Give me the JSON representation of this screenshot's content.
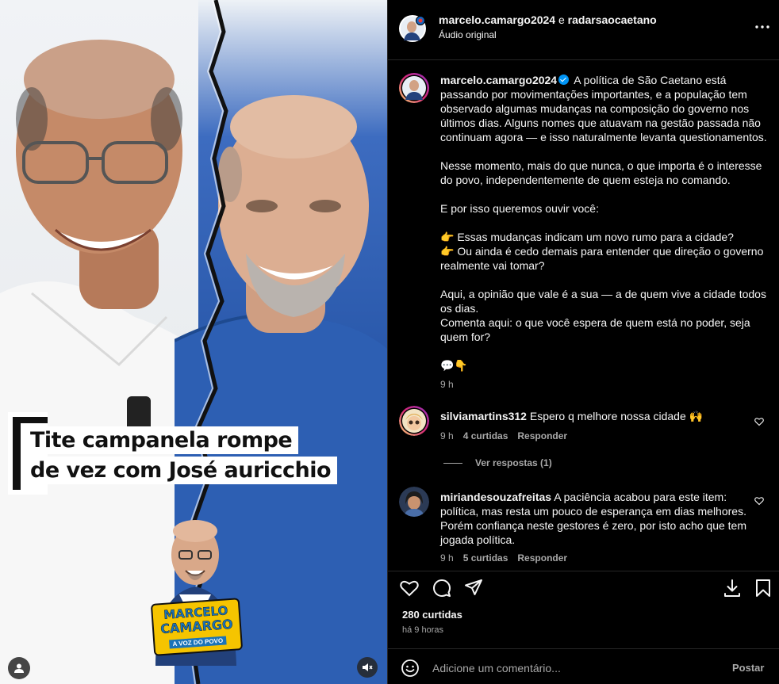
{
  "media": {
    "headline_line1": "Tite campanela rompe",
    "headline_line2": "de vez com José auricchio",
    "badge_line1": "MARCELO",
    "badge_line2": "CAMARGO",
    "badge_line3": "A VOZ DO POVO",
    "user_icon": "user-icon",
    "sound_icon": "speaker-muted-icon"
  },
  "header": {
    "author": "marcelo.camargo2024",
    "separator": " e ",
    "collaborator": "radarsaocaetano",
    "audio": "Áudio original",
    "more_icon": "more-horizontal-icon"
  },
  "caption": {
    "username": "marcelo.camargo2024",
    "p1": "A política de São Caetano está passando por movimentações importantes, e a população tem observado algumas mudanças na composição do governo nos últimos dias. Alguns nomes que atuavam na gestão passada não continuam agora — e isso naturalmente levanta questionamentos.",
    "p2": "Nesse momento, mais do que nunca, o que importa é o interesse do povo, independentemente de quem esteja no comando.",
    "p3": "E por isso queremos ouvir você:",
    "p4a": "👉 Essas mudanças indicam um novo rumo para a cidade?",
    "p4b": "👉 Ou ainda é cedo demais para entender que direção o governo realmente vai tomar?",
    "p5a": "Aqui, a opinião que vale é a sua — a de quem vive a cidade todos os dias.",
    "p5b": "Comenta aqui: o que você espera de quem está no poder, seja quem for?",
    "p6": "💬👇",
    "time": "9 h"
  },
  "comments": [
    {
      "username": "silviamartins312",
      "text": "Espero q melhore nossa cidade 🙌",
      "time": "9 h",
      "likes": "4 curtidas",
      "reply": "Responder"
    },
    {
      "username": "miriandesouzafreitas",
      "text": "A paciência acabou para este item: política, mas resta um pouco de esperança em dias melhores. Porém confiança neste gestores é zero, por isto acho que tem jogada política.",
      "time": "9 h",
      "likes": "5 curtidas",
      "reply": "Responder"
    }
  ],
  "view_replies": "Ver respostas (1)",
  "actions": {
    "like_icon": "heart-icon",
    "comment_icon": "comment-icon",
    "share_icon": "send-icon",
    "download_icon": "download-icon",
    "save_icon": "bookmark-icon"
  },
  "stats": {
    "likes": "280 curtidas",
    "ago": "há 9 horas"
  },
  "composer": {
    "emoji_icon": "emoji-icon",
    "placeholder": "Adicione um comentário...",
    "post": "Postar"
  },
  "colors": {
    "background": "#000000",
    "text": "#f5f5f5",
    "muted": "#a8a8a8",
    "verified": "#0095f6",
    "badge_yellow": "#f5c400"
  }
}
